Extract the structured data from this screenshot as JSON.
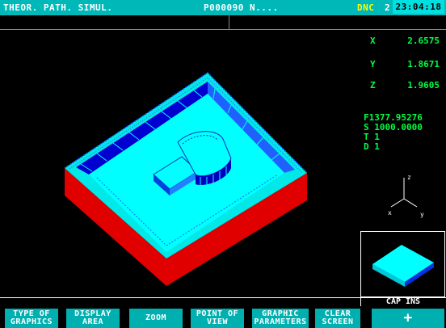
{
  "title_bar": {
    "mode": "THEOR. PATH. SIMUL.",
    "program": "P000090 N....",
    "dnc": "DNC",
    "channel": "2",
    "clock": "23:04:18"
  },
  "axes": [
    {
      "label": "X",
      "value": "2.6575"
    },
    {
      "label": "Y",
      "value": "1.8671"
    },
    {
      "label": "Z",
      "value": "1.9605"
    }
  ],
  "status": {
    "feed": "F1377.95276",
    "spindle": "S 1000.0000",
    "tool": "T    1",
    "offset": "D    1"
  },
  "triad": {
    "z": "z",
    "x": "x",
    "y": "y"
  },
  "caps_indicator": "CAP INS",
  "softkeys": [
    {
      "line1": "TYPE OF",
      "line2": "GRAPHICS"
    },
    {
      "line1": "DISPLAY",
      "line2": "AREA"
    },
    {
      "line1": "ZOOM",
      "line2": ""
    },
    {
      "line1": "POINT OF",
      "line2": "VIEW"
    },
    {
      "line1": "GRAPHIC",
      "line2": "PARAMETERS"
    },
    {
      "line1": "CLEAR",
      "line2": "SCREEN"
    },
    {
      "line1": "+",
      "line2": ""
    }
  ],
  "colors": {
    "title_bg": "#00b8b8",
    "readout": "#00ff40",
    "block_red": "#e00000",
    "floor_cyan": "#00ffff",
    "wall_blue": "#0000d0",
    "softkey_bg": "#00b0b0"
  }
}
